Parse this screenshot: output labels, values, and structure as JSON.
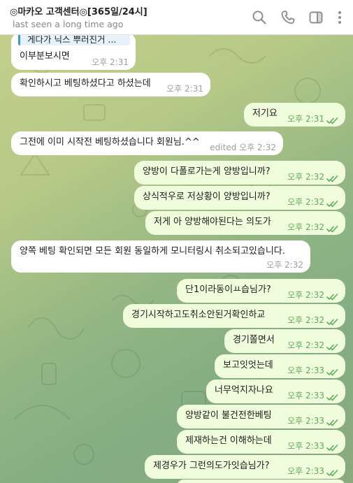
{
  "header": {
    "title": "◎마카오 고객센터◎[365일/24시]",
    "status": "last seen a long time ago",
    "icons": [
      "search-icon",
      "phone-icon",
      "sidebar-icon",
      "more-icon"
    ]
  },
  "colors": {
    "incoming_bubble": "#ffffff",
    "outgoing_bubble": "#effddd",
    "outgoing_meta": "#5fad56",
    "header_bg": "#ffffff"
  },
  "messages": [
    {
      "dir": "in",
      "quote": "게다가 닉스 뿌러진거 ...",
      "text": "이부분보시면",
      "meta": "오후 2:31"
    },
    {
      "dir": "in",
      "text": "확인하시고 베팅하셨다고 하셨는데",
      "meta": "오후 2:31"
    },
    {
      "dir": "out",
      "text": "저기요",
      "meta": "오후 2:31"
    },
    {
      "dir": "in",
      "text": "그전에 이미 시작전 베팅하셨습니다 회원님.^^",
      "meta": "edited 오후 2:32"
    },
    {
      "dir": "out",
      "text": "양방이 다폴로가는게 양방입니까?",
      "meta": "오후 2:32"
    },
    {
      "dir": "out",
      "text": "상식적우로 저상황이 양방입니까?",
      "meta": "오후 2:32"
    },
    {
      "dir": "out",
      "text": "저게 아 양방해야된다는 의도가",
      "meta": "오후 2:32"
    },
    {
      "dir": "in",
      "text": "양쪽 베팅 확인되면 모든 회원 동일하게 모니터링시 취소되고있습니다.",
      "meta": "오후 2:32"
    },
    {
      "dir": "out",
      "text": "단1이라동이ㅛ습님가?",
      "meta": "오후 2:32"
    },
    {
      "dir": "out",
      "text": "경기시작하고도취소안된거확인하교",
      "meta": "오후 2:32"
    },
    {
      "dir": "out",
      "text": "경기쫄면서",
      "meta": "오후 2:32"
    },
    {
      "dir": "out",
      "text": "보고잇엇는데",
      "meta": "오후 2:33"
    },
    {
      "dir": "out",
      "text": "너무억지자나요",
      "meta": "오후 2:33"
    },
    {
      "dir": "out",
      "text": "양방같이 불건전한베팅",
      "meta": "오후 2:33"
    },
    {
      "dir": "out",
      "text": "제재하는건 이해하는데",
      "meta": "오후 2:33"
    },
    {
      "dir": "out",
      "text": "제경우가 그런의도가잇습님가?",
      "meta": "오후 2:33"
    }
  ]
}
